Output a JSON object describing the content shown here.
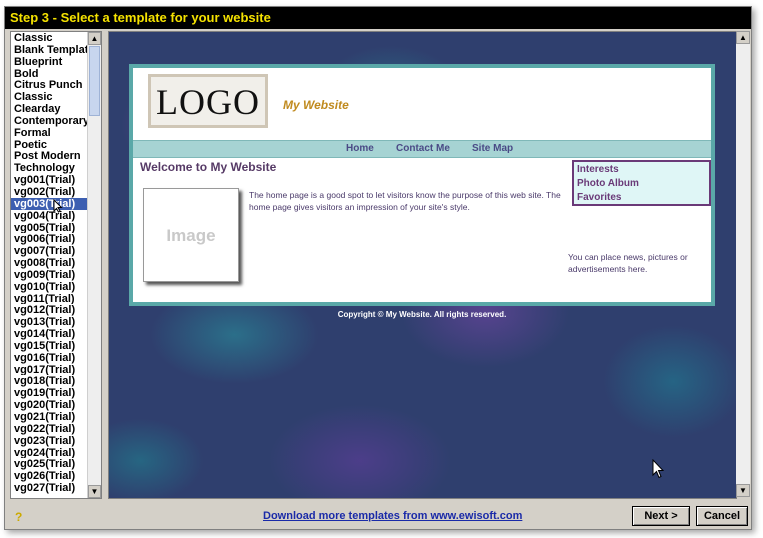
{
  "window": {
    "title": "Step 3 - Select a template for your website"
  },
  "template_list": {
    "items": [
      "Classic",
      "Blank Template",
      "Blueprint",
      "Bold",
      "Citrus Punch",
      "Classic",
      "Clearday",
      "Contemporary",
      "Formal",
      "Poetic",
      "Post Modern",
      "Technology",
      "vg001(Trial)",
      "vg002(Trial)",
      "vg003(Trial)",
      "vg004(Trial)",
      "vg005(Trial)",
      "vg006(Trial)",
      "vg007(Trial)",
      "vg008(Trial)",
      "vg009(Trial)",
      "vg010(Trial)",
      "vg011(Trial)",
      "vg012(Trial)",
      "vg013(Trial)",
      "vg014(Trial)",
      "vg015(Trial)",
      "vg016(Trial)",
      "vg017(Trial)",
      "vg018(Trial)",
      "vg019(Trial)",
      "vg020(Trial)",
      "vg021(Trial)",
      "vg022(Trial)",
      "vg023(Trial)",
      "vg024(Trial)",
      "vg025(Trial)",
      "vg026(Trial)",
      "vg027(Trial)"
    ],
    "selected": "vg003(Trial)"
  },
  "preview": {
    "logo_text": "LOGO",
    "site_title": "My Website",
    "nav": [
      "Home",
      "Contact Me",
      "Site Map"
    ],
    "welcome": "Welcome to My Website",
    "image_placeholder": "Image",
    "body_text": "The home page is a good spot to let visitors know the purpose of this web site. The home page gives visitors an impression of your site's style.",
    "sidebar": [
      "Interests",
      "Photo Album",
      "Favorites"
    ],
    "side_note": "You can place news, pictures or advertisements here.",
    "copyright": "Copyright © My Website. All rights reserved."
  },
  "footer": {
    "download_link": "Download more templates from www.ewisoft.com",
    "next_label": "Next >",
    "cancel_label": "Cancel"
  },
  "colors": {
    "title_bar": "#000000",
    "title_text": "#f5e200",
    "selection": "#3d5fb1",
    "nav_bar": "#a6d3d3",
    "link": "#1a2aa8"
  }
}
